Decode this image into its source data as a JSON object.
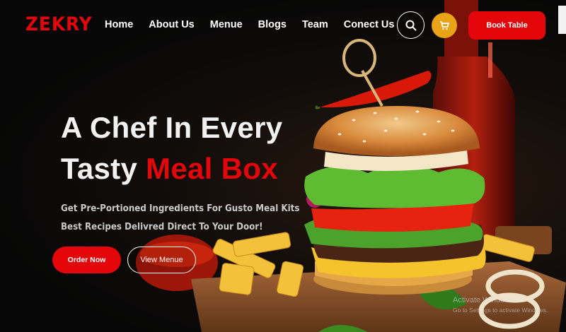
{
  "brand": {
    "logo": "ZEKRY"
  },
  "nav": {
    "items": [
      "Home",
      "About Us",
      "Menue",
      "Blogs",
      "Team",
      "Conect Us"
    ],
    "search_icon": "search-icon",
    "cart_icon": "cart-icon",
    "book_label": "Book Table"
  },
  "hero": {
    "line1": "A Chef In Every",
    "line2_plain": "Tasty ",
    "line2_accent": "Meal Box",
    "sub1": "Get Pre-Portioned Ingredients For Gusto Meal Kits",
    "sub2": "Best Recipes Delivred Direct To Your Door!",
    "order_label": "Order Now",
    "menu_label": "View Menue"
  },
  "watermark": {
    "line1": "Activate Windows",
    "line2": "Go to Settings to activate Windows."
  },
  "colors": {
    "accent": "#e3060b",
    "cart": "#e8a317",
    "background": "#080808"
  }
}
